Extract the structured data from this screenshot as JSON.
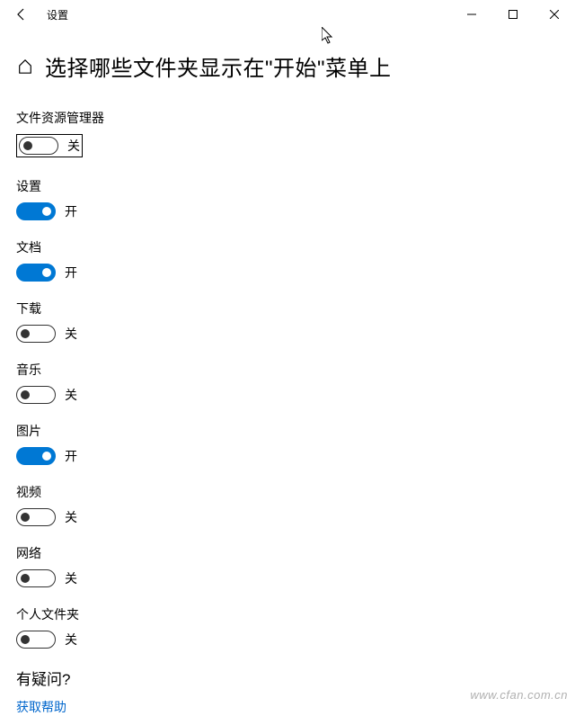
{
  "window": {
    "title": "设置"
  },
  "page": {
    "title": "选择哪些文件夹显示在\"开始\"菜单上"
  },
  "state": {
    "on": "开",
    "off": "关"
  },
  "settings": [
    {
      "label": "文件资源管理器",
      "value": false,
      "highlighted": true
    },
    {
      "label": "设置",
      "value": true
    },
    {
      "label": "文档",
      "value": true
    },
    {
      "label": "下载",
      "value": false
    },
    {
      "label": "音乐",
      "value": false
    },
    {
      "label": "图片",
      "value": true
    },
    {
      "label": "视频",
      "value": false
    },
    {
      "label": "网络",
      "value": false
    },
    {
      "label": "个人文件夹",
      "value": false
    }
  ],
  "help": {
    "title": "有疑问?",
    "link": "获取帮助"
  },
  "watermark": "www.cfan.com.cn"
}
